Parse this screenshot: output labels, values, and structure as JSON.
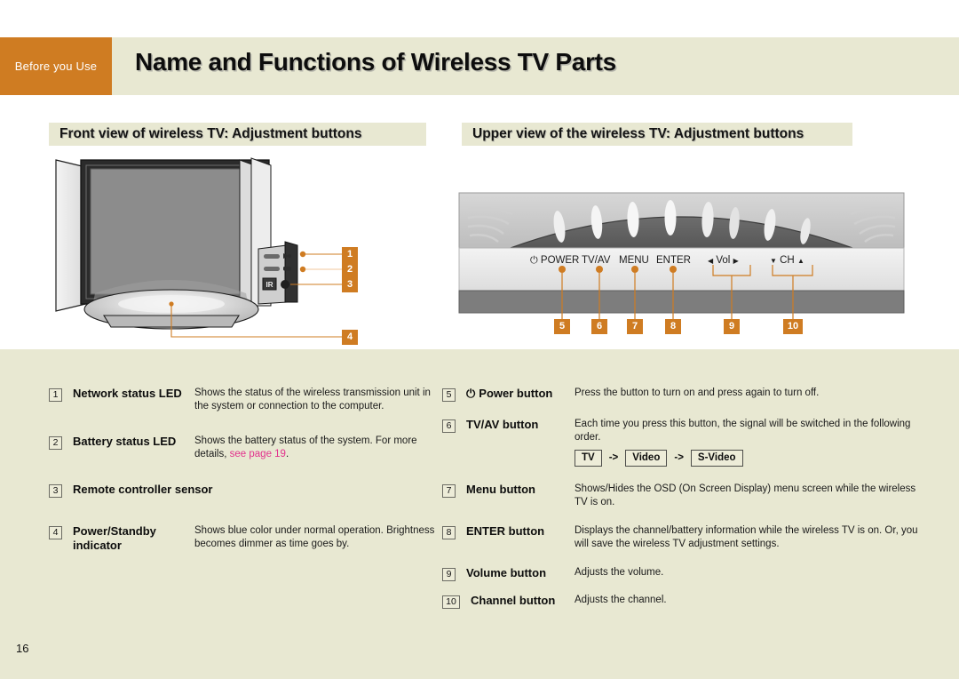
{
  "header": {
    "tab_label": "Before you Use",
    "title": "Name and Functions of Wireless TV Parts",
    "tab_color": "#cf7c22",
    "band_color": "#e8e8d2"
  },
  "sections": {
    "left_title": "Front view of wireless TV: Adjustment buttons",
    "right_title": "Upper view of the wireless TV: Adjustment buttons"
  },
  "figures": {
    "front_view": {
      "ir_label": "IR",
      "callouts": [
        "1",
        "2",
        "3",
        "4"
      ]
    },
    "upper_view": {
      "button_labels": [
        "POWER",
        "TV/AV",
        "MENU",
        "ENTER",
        "Vol",
        "CH"
      ],
      "power_glyph": "⏻",
      "vol_left_arrow": "◀",
      "vol_right_arrow": "▶",
      "ch_down_arrow": "▼",
      "ch_up_arrow": "▲",
      "callouts": [
        "5",
        "6",
        "7",
        "8",
        "9",
        "10"
      ]
    }
  },
  "descriptions_left": [
    {
      "num": "1",
      "name": "Network status LED",
      "body": "Shows the status of the wireless transmission unit in the system or connection to the computer."
    },
    {
      "num": "2",
      "name": "Battery status LED",
      "body_pre": "Shows the battery status of the system. For more details, ",
      "body_link": "see page 19",
      "body_post": "."
    },
    {
      "num": "3",
      "name": "Remote controller sensor",
      "body": ""
    },
    {
      "num": "4",
      "name": "Power/Standby indicator",
      "body": "Shows blue color under normal operation. Brightness becomes dimmer as time goes by."
    }
  ],
  "descriptions_right": [
    {
      "num": "5",
      "glyph": "⏻",
      "name": "Power button",
      "body": "Press the button to turn on and press again to turn off."
    },
    {
      "num": "6",
      "name": "TV/AV button",
      "body": "Each time you press this button, the signal will be switched in the following order.",
      "chain": [
        "TV",
        "Video",
        "S-Video"
      ],
      "chain_arrow": "->"
    },
    {
      "num": "7",
      "name": "Menu button",
      "body": "Shows/Hides the OSD (On Screen Display) menu screen while the wireless TV is on."
    },
    {
      "num": "8",
      "name": "ENTER button",
      "body": "Displays the channel/battery information while the wireless TV is on. Or, you will save the wireless TV adjustment settings."
    },
    {
      "num": "9",
      "name": "Volume button",
      "body": "Adjusts the volume."
    },
    {
      "num": "10",
      "name": "Channel button",
      "body": "Adjusts the channel."
    }
  ],
  "footer": {
    "page_number": "16"
  },
  "colors": {
    "accent_orange": "#cf7c22",
    "beige": "#e8e8d2",
    "link_pink": "#e2318c"
  }
}
